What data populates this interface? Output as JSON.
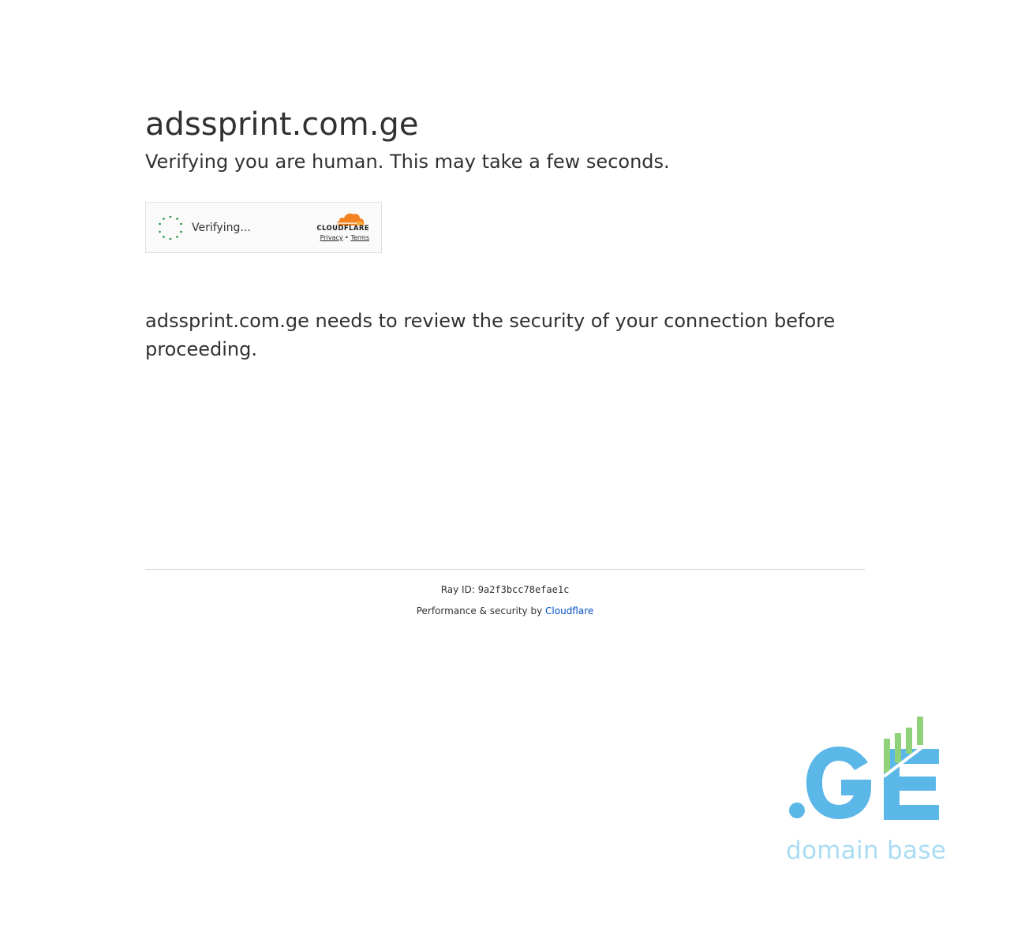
{
  "page": {
    "site_title": "adssprint.com.ge",
    "subtitle": "Verifying you are human. This may take a few seconds.",
    "description": "adssprint.com.ge needs to review the security of your connection before proceeding."
  },
  "widget": {
    "status_text": "Verifying...",
    "brand_wordmark": "CLOUDFLARE",
    "privacy_link": "Privacy",
    "separator": "•",
    "terms_link": "Terms",
    "spinner_color": "#1e8e3e",
    "cloud_color": "#f48120"
  },
  "footer": {
    "ray_label": "Ray ID:",
    "ray_id": "9a2f3bcc78efae1c",
    "perf_text": "Performance & security by",
    "perf_link": "Cloudflare",
    "link_color": "#0051c3"
  },
  "logo": {
    "mark": ".GE",
    "tagline": "domain base",
    "blue": "#5bb7e8",
    "green": "#8fd27a"
  }
}
